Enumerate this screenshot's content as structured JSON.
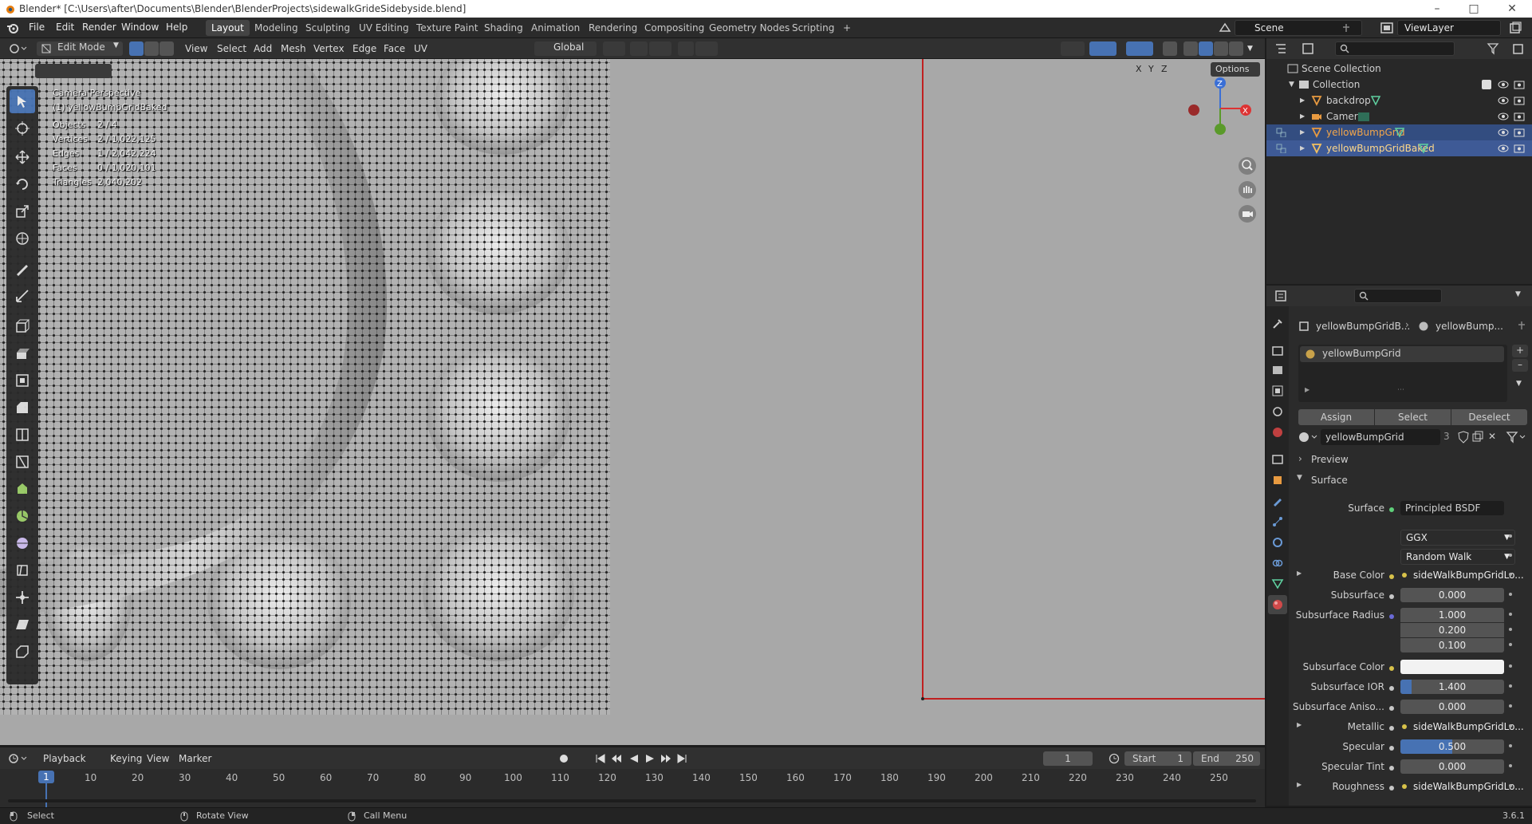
{
  "window": {
    "title": "Blender* [C:\\Users\\after\\Documents\\Blender\\BlenderProjects\\sidewalkGrideSidebyside.blend]"
  },
  "menu": [
    "File",
    "Edit",
    "Render",
    "Window",
    "Help"
  ],
  "workspaces": [
    "Layout",
    "Modeling",
    "Sculpting",
    "UV Editing",
    "Texture Paint",
    "Shading",
    "Animation",
    "Rendering",
    "Compositing",
    "Geometry Nodes",
    "Scripting",
    "+"
  ],
  "scene": {
    "name": "Scene",
    "view_layer": "ViewLayer"
  },
  "viewport_header": {
    "mode": "Edit Mode",
    "menus": [
      "View",
      "Select",
      "Add",
      "Mesh",
      "Vertex",
      "Edge",
      "Face",
      "UV"
    ],
    "orientation": "Global",
    "axes": [
      "X",
      "Y",
      "Z"
    ],
    "options": "Options"
  },
  "viewport_overlay": {
    "view_name": "Camera Perspective",
    "object_name": "(1) yellowBumpGridBaked",
    "stats": [
      {
        "label": "Objects",
        "value": "2 / 4"
      },
      {
        "label": "Vertices",
        "value": "2 / 1,022,125"
      },
      {
        "label": "Edges",
        "value": "1 / 2,042,224"
      },
      {
        "label": "Faces",
        "value": "0 / 1,020,101"
      },
      {
        "label": "Triangles",
        "value": "2,040,202"
      }
    ]
  },
  "gizmo": {
    "z": "Z",
    "x": "X"
  },
  "outliner": {
    "root": "Scene Collection",
    "collection": "Collection",
    "items": [
      {
        "name": "backdrop",
        "selected": false
      },
      {
        "name": "Camera",
        "selected": false
      },
      {
        "name": "yellowBumpGrid",
        "selected": true
      },
      {
        "name": "yellowBumpGridBaked",
        "selected": true
      }
    ]
  },
  "properties": {
    "breadcrumb_object": "yellowBumpGridB...",
    "breadcrumb_material": "yellowBump...",
    "material_slot": "yellowBumpGrid",
    "buttons": [
      "Assign",
      "Select",
      "Deselect"
    ],
    "material_name": "yellowBumpGrid",
    "material_users": "3",
    "sections": {
      "preview": "Preview",
      "surface": "Surface"
    },
    "surface_shader_label": "Surface",
    "surface_shader": "Principled BSDF",
    "distribution": "GGX",
    "subsurface_method": "Random Walk",
    "rows": [
      {
        "label": "Base Color",
        "value": "sideWalkBumpGridLo...",
        "type": "link"
      },
      {
        "label": "Subsurface",
        "value": "0.000",
        "type": "num"
      },
      {
        "label": "Subsurface Radius",
        "value": "1.000",
        "type": "num"
      },
      {
        "label": "",
        "value": "0.200",
        "type": "num"
      },
      {
        "label": "",
        "value": "0.100",
        "type": "num"
      },
      {
        "label": "Subsurface Color",
        "value": "",
        "type": "color"
      },
      {
        "label": "Subsurface IOR",
        "value": "1.400",
        "type": "num"
      },
      {
        "label": "Subsurface Aniso...",
        "value": "0.000",
        "type": "num"
      },
      {
        "label": "Metallic",
        "value": "sideWalkBumpGridLo...",
        "type": "link"
      },
      {
        "label": "Specular",
        "value": "0.500",
        "type": "slider"
      },
      {
        "label": "Specular Tint",
        "value": "0.000",
        "type": "num"
      },
      {
        "label": "Roughness",
        "value": "sideWalkBumpGridLo...",
        "type": "link"
      }
    ]
  },
  "timeline": {
    "menus": [
      "Playback",
      "Keying",
      "View",
      "Marker"
    ],
    "current_frame": "1",
    "start_label": "Start",
    "start": "1",
    "end_label": "End",
    "end": "250",
    "ticks": [
      "1",
      "10",
      "20",
      "30",
      "40",
      "50",
      "60",
      "70",
      "80",
      "90",
      "100",
      "110",
      "120",
      "130",
      "140",
      "150",
      "160",
      "170",
      "180",
      "190",
      "200",
      "210",
      "220",
      "230",
      "240",
      "250"
    ]
  },
  "statusbar": {
    "items": [
      "Select",
      "Rotate View",
      "Call Menu"
    ],
    "version": "3.6.1"
  }
}
